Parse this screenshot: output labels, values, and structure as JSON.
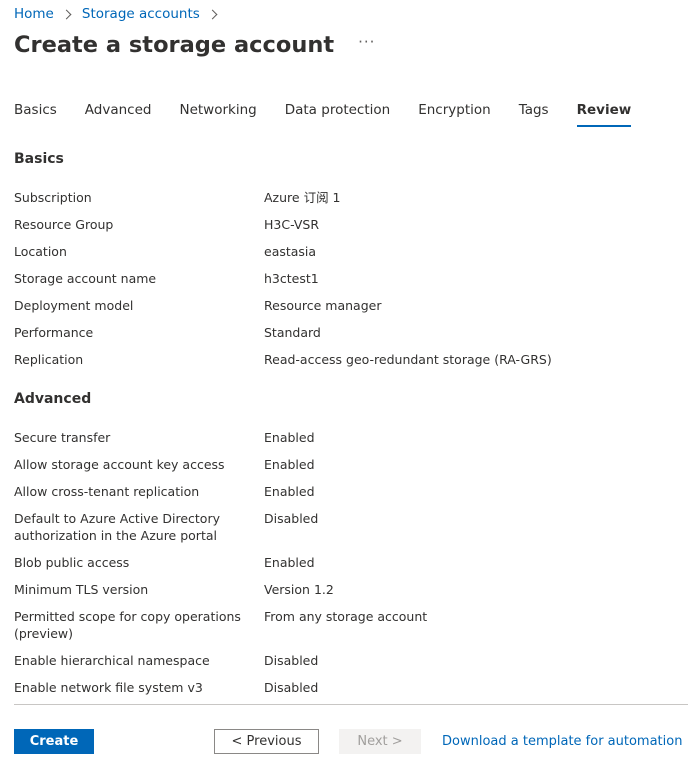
{
  "breadcrumb": {
    "items": [
      "Home",
      "Storage accounts"
    ]
  },
  "header": {
    "title": "Create a storage account",
    "more": "···"
  },
  "tabs": [
    {
      "label": "Basics",
      "active": false
    },
    {
      "label": "Advanced",
      "active": false
    },
    {
      "label": "Networking",
      "active": false
    },
    {
      "label": "Data protection",
      "active": false
    },
    {
      "label": "Encryption",
      "active": false
    },
    {
      "label": "Tags",
      "active": false
    },
    {
      "label": "Review",
      "active": true
    }
  ],
  "sections": [
    {
      "title": "Basics",
      "rows": [
        {
          "label": "Subscription",
          "value": "Azure 订阅 1"
        },
        {
          "label": "Resource Group",
          "value": "H3C-VSR"
        },
        {
          "label": "Location",
          "value": "eastasia"
        },
        {
          "label": "Storage account name",
          "value": "h3ctest1"
        },
        {
          "label": "Deployment model",
          "value": "Resource manager"
        },
        {
          "label": "Performance",
          "value": "Standard"
        },
        {
          "label": "Replication",
          "value": "Read-access geo-redundant storage (RA-GRS)"
        }
      ]
    },
    {
      "title": "Advanced",
      "rows": [
        {
          "label": "Secure transfer",
          "value": "Enabled"
        },
        {
          "label": "Allow storage account key access",
          "value": "Enabled"
        },
        {
          "label": "Allow cross-tenant replication",
          "value": "Enabled"
        },
        {
          "label": "Default to Azure Active Directory authorization in the Azure portal",
          "value": "Disabled"
        },
        {
          "label": "Blob public access",
          "value": "Enabled"
        },
        {
          "label": "Minimum TLS version",
          "value": "Version 1.2"
        },
        {
          "label": "Permitted scope for copy operations (preview)",
          "value": "From any storage account"
        },
        {
          "label": "Enable hierarchical namespace",
          "value": "Disabled"
        },
        {
          "label": "Enable network file system v3",
          "value": "Disabled"
        }
      ]
    }
  ],
  "footer": {
    "create_label": "Create",
    "previous_label": "< Previous",
    "next_label": "Next >",
    "template_link": "Download a template for automation"
  },
  "colors": {
    "accent": "#0067b8",
    "text": "#323130",
    "disabled_bg": "#f3f2f1",
    "disabled_text": "#a19f9d",
    "divider": "#c8c6c4"
  }
}
